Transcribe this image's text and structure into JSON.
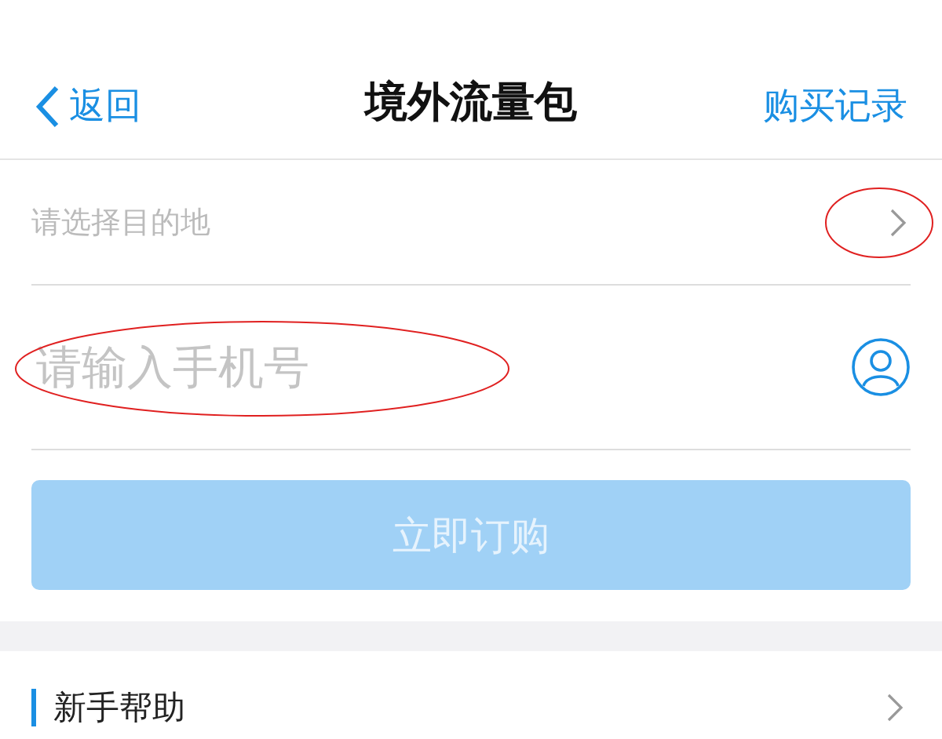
{
  "header": {
    "back": "返回",
    "title": "境外流量包",
    "action": "购买记录"
  },
  "destination": {
    "prompt": "请选择目的地",
    "highlighted": true
  },
  "phone": {
    "placeholder": "请输入手机号",
    "highlighted": true
  },
  "order_button": {
    "label": "立即订购",
    "disabled": true
  },
  "help": {
    "label": "新手帮助"
  }
}
